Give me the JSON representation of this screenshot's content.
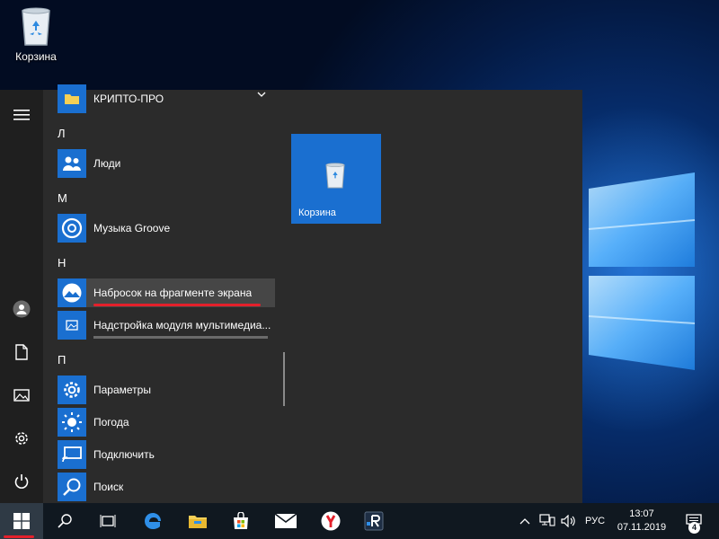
{
  "desktop": {
    "icon_label": "Корзина"
  },
  "start_menu": {
    "sections": [
      {
        "letter": "",
        "apps": [
          {
            "name": "КРИПТО-ПРО",
            "icon": "folder-icon",
            "expandable": true
          }
        ]
      },
      {
        "letter": "Л",
        "apps": [
          {
            "name": "Люди",
            "icon": "people-icon"
          }
        ]
      },
      {
        "letter": "М",
        "apps": [
          {
            "name": "Музыка Groove",
            "icon": "groove-music-icon"
          }
        ]
      },
      {
        "letter": "Н",
        "apps": [
          {
            "name": "Набросок на фрагменте экрана",
            "icon": "snip-sketch-icon",
            "highlighted": true
          },
          {
            "name": "Надстройка модуля мультимедиа...",
            "icon": "media-addon-icon",
            "progress": 1.0
          }
        ]
      },
      {
        "letter": "П",
        "apps": [
          {
            "name": "Параметры",
            "icon": "gear-icon"
          },
          {
            "name": "Погода",
            "icon": "weather-icon"
          },
          {
            "name": "Подключить",
            "icon": "connect-icon"
          },
          {
            "name": "Поиск",
            "icon": "search-icon"
          }
        ]
      }
    ],
    "tile": {
      "label": "Корзина",
      "icon": "recycle-bin-icon"
    },
    "rail": [
      "hamburger-icon",
      "user-icon",
      "document-icon",
      "pictures-icon",
      "settings-icon",
      "power-icon"
    ]
  },
  "taskbar": {
    "items": [
      "start-icon",
      "search-icon",
      "task-view-icon",
      "edge-icon",
      "explorer-icon",
      "store-icon",
      "mail-icon",
      "yandex-icon",
      "app-r-icon"
    ],
    "language": "РУС",
    "time": "13:07",
    "date": "07.11.2019",
    "notifications_count": "4"
  },
  "colors": {
    "accent": "#1a6fd0",
    "menu_bg": "#2b2b2b",
    "rail_bg": "#1f1f1f",
    "taskbar_bg": "#101820",
    "highlight_red": "#e4202b"
  }
}
